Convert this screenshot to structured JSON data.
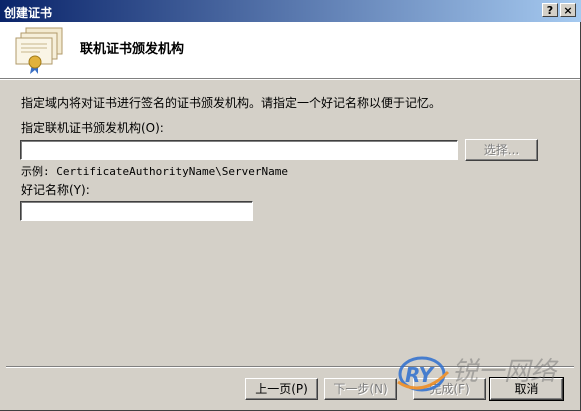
{
  "window": {
    "title": "创建证书",
    "help_button": "?",
    "close_button": "×"
  },
  "header": {
    "title": "联机证书颁发机构",
    "icon": "certificate-icon"
  },
  "body": {
    "description": "指定域内将对证书进行签名的证书颁发机构。请指定一个好记名称以便于记忆。",
    "ca_label": "指定联机证书颁发机构(O):",
    "ca_value": "",
    "select_button": "选择...",
    "example_text": "示例: CertificateAuthorityName\\ServerName",
    "friendly_label": "好记名称(Y):",
    "friendly_value": ""
  },
  "footer": {
    "back_button": "上一页(P)",
    "next_button": "下一步(N)",
    "finish_button": "完成(F)",
    "cancel_button": "取消"
  },
  "watermark": {
    "logo_text": "RY",
    "site_text": "锐一网络"
  }
}
